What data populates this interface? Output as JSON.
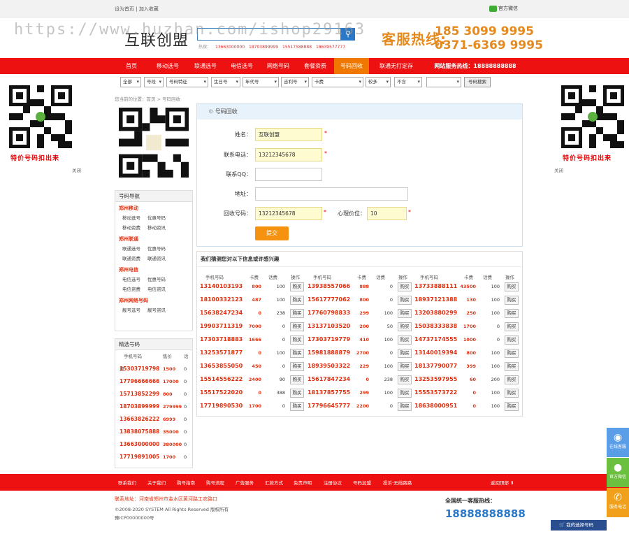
{
  "topbar": {
    "home": "设为首页",
    "fav": "加入收藏",
    "wechat": "官方微信"
  },
  "watermark": "https://www.huzhan.com/ishop29163",
  "logo": "互联创盟",
  "hotline": {
    "label": "热搜：",
    "nums": [
      "13663000000",
      "18703899999",
      "15517588888",
      "18639577777"
    ]
  },
  "kefu": {
    "label": "客服热线:",
    "mobile": "185 3099 9995",
    "tel": "0371-6369 9995"
  },
  "nav": {
    "items": [
      "首页",
      "移动选号",
      "联通选号",
      "电信选号",
      "网络号码",
      "套餐资费",
      "号码回收",
      "联通无打定存"
    ],
    "active": 6,
    "service": "网站服务热线：18888888888"
  },
  "filter": {
    "selects": [
      "全部",
      "号段",
      "号码特征",
      "生日号",
      "年代号",
      "吉利号",
      "卡费",
      "较多",
      "不含"
    ],
    "button": "号码搜索"
  },
  "qr_caption": "特价号码扣出来",
  "close": "关闭",
  "breadcrumb": "您当前的位置：首页 > 号码回收",
  "nav_box": {
    "title": "号码导航",
    "groups": [
      {
        "name": "郑州移动",
        "links": [
          [
            "移动选号",
            "优惠号码"
          ],
          [
            "移动资费",
            "移动资讯"
          ]
        ]
      },
      {
        "name": "郑州联通",
        "links": [
          [
            "联通选号",
            "优惠号码"
          ],
          [
            "联通资费",
            "联通资讯"
          ]
        ]
      },
      {
        "name": "郑州电信",
        "links": [
          [
            "电信选号",
            "优惠号码"
          ],
          [
            "电信资费",
            "电信资讯"
          ]
        ]
      },
      {
        "name": "郑州网络号码",
        "links": [
          [
            "靓号选号",
            "靓号资讯"
          ]
        ]
      }
    ]
  },
  "jx": {
    "title": "精选号码",
    "cols": [
      "手机号码",
      "售价",
      "话费"
    ],
    "rows": [
      [
        "15303719798",
        "1500",
        "0"
      ],
      [
        "17796666666",
        "17000",
        "0"
      ],
      [
        "15713852299",
        "800",
        "0"
      ],
      [
        "18703899999",
        "279999",
        "0"
      ],
      [
        "13663826222",
        "6999",
        "0"
      ],
      [
        "13838075888",
        "35000",
        "0"
      ],
      [
        "13663000000",
        "380000",
        "0"
      ],
      [
        "17719891005",
        "1700",
        "0"
      ]
    ]
  },
  "form": {
    "title": "号码回收",
    "name_label": "姓名：",
    "name_value": "互联创盟",
    "phone_label": "联系电话：",
    "phone_value": "13212345678",
    "qq_label": "联系QQ：",
    "addr_label": "地址：",
    "num_label": "回收号码：",
    "num_value": "13212345678",
    "price_label": "心理价位：",
    "price_value": "10",
    "submit": "提交"
  },
  "list": {
    "title": "我们猜测您对以下信息或许感兴趣",
    "cols": [
      "手机号码",
      "卡费",
      "话费",
      "操作"
    ],
    "buy": "购买",
    "rows": [
      [
        [
          "13140103193",
          "800",
          "100"
        ],
        [
          "13938557066",
          "888",
          "0"
        ],
        [
          "13733888111",
          "43500",
          "100"
        ]
      ],
      [
        [
          "18100332123",
          "487",
          "100"
        ],
        [
          "15617777062",
          "800",
          "0"
        ],
        [
          "18937121388",
          "130",
          "100"
        ]
      ],
      [
        [
          "15638247234",
          "0",
          "238"
        ],
        [
          "17760798833",
          "299",
          "100"
        ],
        [
          "13203880299",
          "250",
          "100"
        ]
      ],
      [
        [
          "19903711319",
          "7000",
          "0"
        ],
        [
          "13137103520",
          "200",
          "50"
        ],
        [
          "15038333838",
          "1700",
          "0"
        ]
      ],
      [
        [
          "17303718883",
          "1666",
          "0"
        ],
        [
          "17303719779",
          "410",
          "100"
        ],
        [
          "14737174555",
          "1000",
          "0"
        ]
      ],
      [
        [
          "13253571877",
          "0",
          "100"
        ],
        [
          "15981888879",
          "2700",
          "0"
        ],
        [
          "13140019394",
          "800",
          "100"
        ]
      ],
      [
        [
          "13653855050",
          "450",
          "0"
        ],
        [
          "18939503322",
          "229",
          "100"
        ],
        [
          "18137790077",
          "399",
          "100"
        ]
      ],
      [
        [
          "15514556222",
          "2400",
          "90"
        ],
        [
          "15617847234",
          "0",
          "238"
        ],
        [
          "13253597955",
          "60",
          "200"
        ]
      ],
      [
        [
          "15517522020",
          "0",
          "388"
        ],
        [
          "18137857755",
          "299",
          "100"
        ],
        [
          "15553573722",
          "0",
          "100"
        ]
      ],
      [
        [
          "17719890530",
          "1700",
          "0"
        ],
        [
          "17796645777",
          "2200",
          "0"
        ],
        [
          "18638000951",
          "0",
          "100"
        ]
      ]
    ]
  },
  "footer": {
    "links": [
      "联系我们",
      "关于我们",
      "购号指南",
      "购号流程",
      "广告服务",
      "汇款方式",
      "免责声明",
      "注册协议",
      "号码加盟",
      "投诉·无线路路"
    ],
    "top": "返回顶部"
  },
  "bottom": {
    "addr": "联系地址：河南省郑州市金水区黄河路工农路口",
    "copy": "©2008-2020 SYSTEM All Rights Reserved 版权所有",
    "icp": "豫ICP00000000号",
    "svc_label": "全国统一客服热线：",
    "svc_num": "18888888888",
    "cart": "我的选择号码"
  },
  "floatbtns": [
    "在线客服",
    "官方微信",
    "服务电话"
  ]
}
